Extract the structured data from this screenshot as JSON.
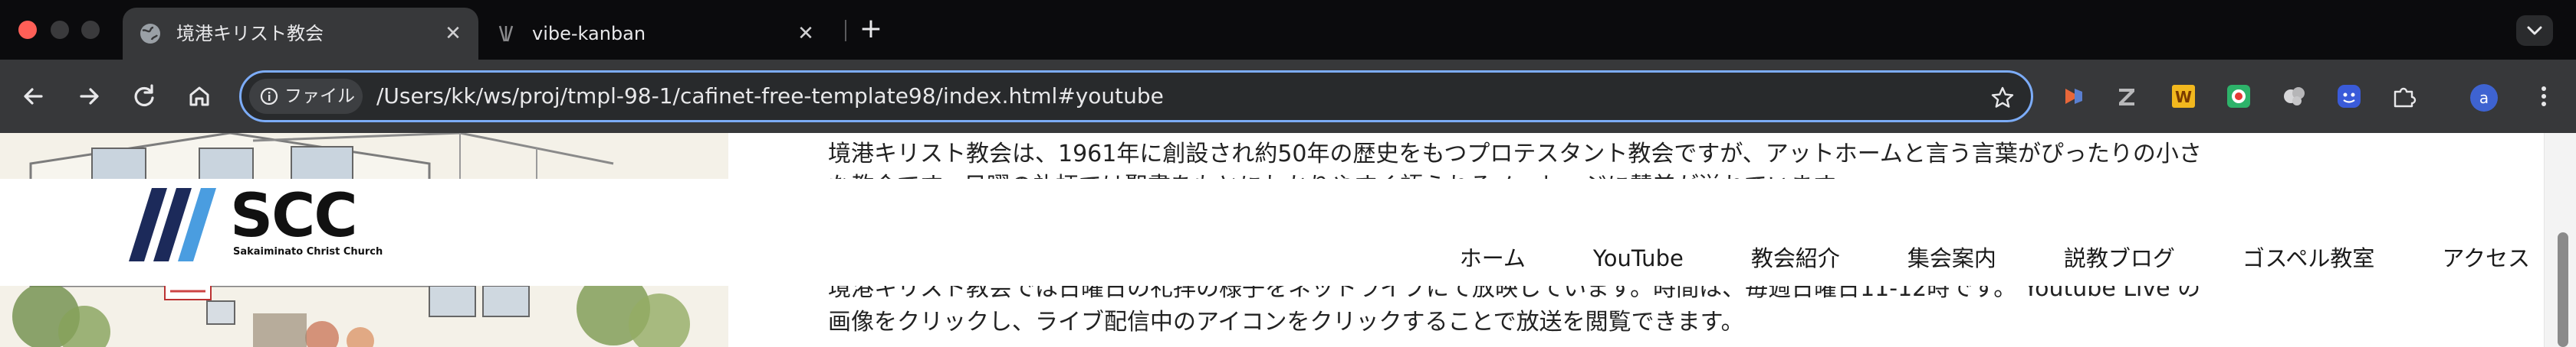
{
  "browser": {
    "tabs": [
      {
        "title": "境港キリスト教会",
        "active": true,
        "icon": "globe-icon"
      },
      {
        "title": "vibe-kanban",
        "active": false,
        "icon": "vibe-kanban-favicon"
      }
    ],
    "new_tab_icon": "plus-icon",
    "address_bar": {
      "chip_icon": "info-icon",
      "chip_label": "ファイル",
      "url": "/Users/kk/ws/proj/tmpl-98-1/cafinet-free-template98/index.html#youtube"
    },
    "extensions": [
      "pocket-extension-icon",
      "zotero-extension-icon",
      "w-extension-icon",
      "record-extension-icon",
      "cookie-extension-icon",
      "face-extension-icon",
      "puzzle-icon"
    ],
    "profile_initial": "a",
    "colors": {
      "tabstrip": "#0b0b0d",
      "toolbar": "#37383a",
      "omnibox_border": "#7cacf8",
      "avatar": "#3e63d1"
    }
  },
  "page": {
    "logo": {
      "text": "SCC",
      "subtitle": "Sakaiminato Christ Church",
      "stripe_colors": [
        "#1c2a5a",
        "#1c2a5a",
        "#4a9de0"
      ]
    },
    "nav": [
      "ホーム",
      "YouTube",
      "教会紹介",
      "集会案内",
      "説教ブログ",
      "ゴスペル教室",
      "アクセス"
    ],
    "intro_line_1": "境港キリスト教会は、1961年に創設され約50年の歴史をもつプロテスタント教会ですが、アットホームと言う言葉がぴったりの小さ",
    "intro_line_2": "な教会です。日曜の礼拝では聖書をもとにわかりやすく語られるメッセージに賛美が溢れています。",
    "live_line_1": "境港キリスト教会では日曜日の礼拝の様子をネットライブにて放映しています。時間は、毎週日曜日11-12時です。 Youtube Live の",
    "live_line_2": "画像をクリックし、ライブ配信中のアイコンをクリックすることで放送を閲覧できます。"
  }
}
